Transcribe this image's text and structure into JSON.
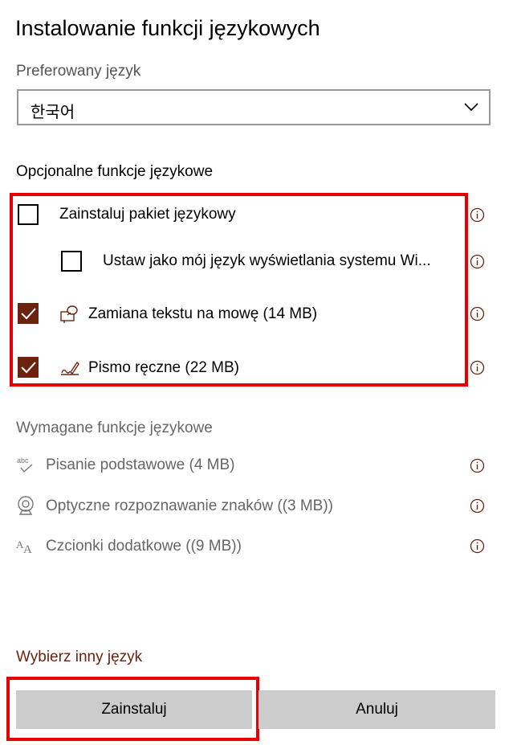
{
  "dialog": {
    "title": "Instalowanie funkcji językowych"
  },
  "preferred": {
    "label": "Preferowany język",
    "selected": "한국어"
  },
  "optional": {
    "heading": "Opcjonalne funkcje językowe",
    "items": [
      {
        "label": "Zainstaluj pakiet językowy",
        "checked": false
      },
      {
        "label": "Ustaw jako mój język wyświetlania systemu Wi...",
        "checked": false
      },
      {
        "label": "Zamiana tekstu na mowę (14 MB)",
        "checked": true,
        "icon": "speech-icon"
      },
      {
        "label": "Pismo ręczne (22 MB)",
        "checked": true,
        "icon": "handwriting-icon"
      }
    ]
  },
  "required": {
    "heading": "Wymagane funkcje językowe",
    "items": [
      {
        "label": "Pisanie podstawowe (4 MB)",
        "icon": "spellcheck-icon"
      },
      {
        "label": "Optyczne rozpoznawanie znaków ((3 MB))",
        "icon": "ocr-camera-icon"
      },
      {
        "label": "Czcionki dodatkowe ((9 MB))",
        "icon": "fonts-icon"
      }
    ]
  },
  "footer": {
    "link": "Wybierz inny język",
    "install_label": "Zainstaluj",
    "cancel_label": "Anuluj"
  },
  "colors": {
    "accent": "#6b2310",
    "highlight": "#e60000",
    "button_bg": "#cccccc"
  }
}
